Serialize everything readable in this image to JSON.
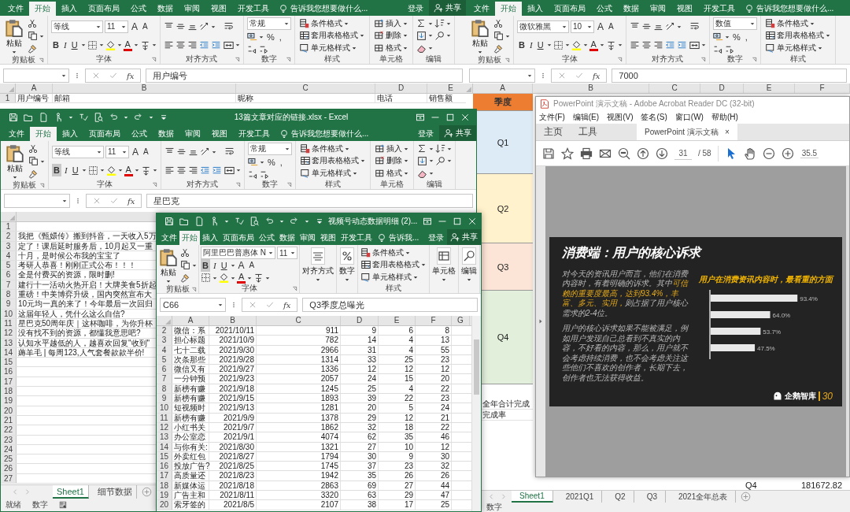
{
  "windows": [
    {
      "kind": "excel_users",
      "tabs": [
        {
          "label": "文件",
          "selected": false
        },
        {
          "label": "开始",
          "selected": true
        },
        {
          "label": "插入",
          "selected": false
        },
        {
          "label": "页面布局",
          "selected": false
        },
        {
          "label": "公式",
          "selected": false
        },
        {
          "label": "数据",
          "selected": false
        },
        {
          "label": "审阅",
          "selected": false
        },
        {
          "label": "视图",
          "selected": false
        },
        {
          "label": "开发工具",
          "selected": false
        }
      ],
      "tell_me": "告诉我您想要做什么...",
      "sign_in": "登录",
      "share": "共享",
      "ribbon": [
        {
          "kind": "clipboard",
          "label": "剪贴板",
          "paste": "粘贴"
        },
        {
          "kind": "font",
          "label": "字体",
          "font": "等线",
          "size": "11",
          "grow": "A",
          "shrink": "A",
          "format_buttons": [
            {
              "label": "B",
              "selected": false
            },
            {
              "label": "I",
              "selected": false
            },
            {
              "label": "U",
              "selected": false
            }
          ],
          "color_letter": "A"
        },
        {
          "kind": "align",
          "label": "对齐方式"
        },
        {
          "kind": "number",
          "label": "数字",
          "format": "常规",
          "percent": "%",
          "comma": ","
        },
        {
          "kind": "styles",
          "label": "样式",
          "items": [
            "条件格式",
            "套用表格格式",
            "单元格样式"
          ]
        },
        {
          "kind": "cells",
          "label": "单元格",
          "items": [
            "插入",
            "删除",
            "格式"
          ]
        },
        {
          "kind": "editing",
          "label": "编辑"
        }
      ],
      "fx": "fx",
      "formula": "用户编号",
      "columns": [
        "A",
        "B",
        "C",
        "D",
        "E"
      ],
      "rows": [
        {
          "number": "1",
          "cells": [
            "用户编号",
            "邮箱",
            "昵称",
            "电话",
            "销售额"
          ]
        }
      ]
    },
    {
      "kind": "excel_links",
      "title": "13篇文章对应的链接.xlsx - Excel",
      "tabs": [
        {
          "label": "文件",
          "selected": false
        },
        {
          "label": "开始",
          "selected": true
        },
        {
          "label": "插入",
          "selected": false
        },
        {
          "label": "页面布局",
          "selected": false
        },
        {
          "label": "公式",
          "selected": false
        },
        {
          "label": "数据",
          "selected": false
        },
        {
          "label": "审阅",
          "selected": false
        },
        {
          "label": "视图",
          "selected": false
        },
        {
          "label": "开发工具",
          "selected": false
        }
      ],
      "tell_me": "告诉我您想要做什么...",
      "sign_in": "登录",
      "share": "共享",
      "ribbon": [
        {
          "kind": "clipboard",
          "label": "剪贴板",
          "paste": "粘贴"
        },
        {
          "kind": "font",
          "label": "字体",
          "font": "等线",
          "size": "11",
          "grow": "A",
          "shrink": "A",
          "format_buttons": [
            {
              "label": "B",
              "selected": true
            },
            {
              "label": "I",
              "selected": false
            },
            {
              "label": "U",
              "selected": false
            }
          ],
          "color_letter": "A"
        },
        {
          "kind": "align",
          "label": "对齐方式"
        },
        {
          "kind": "number",
          "label": "数字",
          "format": "常规",
          "percent": "%",
          "comma": ","
        },
        {
          "kind": "styles",
          "label": "样式",
          "items": [
            "条件格式",
            "套用表格格式",
            "单元格样式"
          ]
        },
        {
          "kind": "cells",
          "label": "单元格",
          "items": [
            "插入",
            "删除",
            "格式"
          ]
        },
        {
          "kind": "editing",
          "label": "编辑"
        }
      ],
      "fx": "fx",
      "formula": "星巴克",
      "rows": [
        {
          "number": "1"
        },
        {
          "number": "2",
          "cells": [
            "我把《甄嬛传》搬到抖音，一天收入5万"
          ]
        },
        {
          "number": "3",
          "cells": [
            "定了！课后延时服务后，10月起又一重"
          ]
        },
        {
          "number": "4",
          "cells": [
            "十月，是时候公布我的宝宝了"
          ]
        },
        {
          "number": "5",
          "cells": [
            "考研人恭喜！刚刚正式公布！！！"
          ]
        },
        {
          "number": "6",
          "cells": [
            "全是付费买的资源，限时删!"
          ]
        },
        {
          "number": "7",
          "cells": [
            "建行十一活动火热开启！大牌美食5折起"
          ]
        },
        {
          "number": "8",
          "cells": [
            "重磅！中美博弈升级，国内突然宣布大"
          ]
        },
        {
          "number": "9",
          "cells": [
            "10元均一真的来了！今年最后一次回归"
          ]
        },
        {
          "number": "10",
          "cells": [
            "这届年轻人，凭什么这么自信?"
          ]
        },
        {
          "number": "11",
          "cells": [
            "星巴克50周年庆｜这杯咖啡，为你升杯"
          ]
        },
        {
          "number": "12",
          "cells": [
            "没有找不到的资源，都懂我意思吧?"
          ]
        },
        {
          "number": "13",
          "cells": [
            "认知水平越低的人，越喜欢回复\"收到\""
          ]
        },
        {
          "number": "14",
          "cells": [
            "薅羊毛 | 每周123,人气套餐款款半价!"
          ]
        },
        {
          "number": "15"
        },
        {
          "number": "16"
        },
        {
          "number": "17"
        },
        {
          "number": "18"
        },
        {
          "number": "19"
        },
        {
          "number": "20"
        },
        {
          "number": "21"
        },
        {
          "number": "22"
        },
        {
          "number": "23"
        },
        {
          "number": "24"
        },
        {
          "number": "25"
        },
        {
          "number": "26"
        },
        {
          "number": "27"
        }
      ],
      "sheet_tabs": [
        {
          "label": "Sheet1",
          "selected": true
        },
        {
          "label": "细节数据",
          "selected": false
        }
      ],
      "status": [
        "就绪",
        "数字"
      ]
    },
    {
      "kind": "excel_video",
      "title": "视频号动态数据明细 (2)...",
      "tabs": [
        {
          "label": "文件",
          "selected": false
        },
        {
          "label": "开始",
          "selected": true
        },
        {
          "label": "插入",
          "selected": false
        },
        {
          "label": "页面布局",
          "selected": false
        },
        {
          "label": "公式",
          "selected": false
        },
        {
          "label": "数据",
          "selected": false
        },
        {
          "label": "审阅",
          "selected": false
        },
        {
          "label": "视图",
          "selected": false
        },
        {
          "label": "开发工具",
          "selected": false
        }
      ],
      "tell_me": "告诉我...",
      "sign_in": "登录",
      "share": "共享",
      "ribbon": [
        {
          "kind": "clipboard",
          "label": "剪贴板",
          "paste": "粘贴"
        },
        {
          "kind": "font_compact",
          "label": "字体",
          "font": "阿里巴巴普惠体 N",
          "size": "11",
          "grow": "A",
          "shrink": "A",
          "format_buttons": [
            {
              "label": "B",
              "selected": true
            },
            {
              "label": "I",
              "selected": false
            },
            {
              "label": "U",
              "selected": false
            }
          ],
          "color_letter": "A"
        },
        {
          "kind": "align_button",
          "text": "对齐方式"
        },
        {
          "kind": "number_button",
          "text": "数字"
        },
        {
          "kind": "styles",
          "label": "样式",
          "items": [
            "条件格式",
            "套用表格格式",
            "单元格样式"
          ]
        },
        {
          "kind": "cells_button",
          "text": "单元格"
        },
        {
          "kind": "editing_button",
          "text": "编辑"
        }
      ],
      "name_box": "C66",
      "fx": "fx",
      "formula": "Q3季度总曝光",
      "columns": [
        "A",
        "B",
        "C",
        "D",
        "E",
        "F",
        "G"
      ],
      "rows": [
        {
          "number": "2",
          "cells": [
            "微信：系",
            "2021/10/11",
            "911",
            "9",
            "6",
            "8"
          ]
        },
        {
          "number": "3",
          "cells": [
            "担心标题",
            "2021/10/9",
            "782",
            "14",
            "4",
            "13"
          ]
        },
        {
          "number": "4",
          "cells": [
            "七十二载",
            "2021/9/30",
            "2966",
            "31",
            "4",
            "55"
          ]
        },
        {
          "number": "5",
          "cells": [
            "次条那些",
            "2021/9/28",
            "1314",
            "33",
            "25",
            "23"
          ]
        },
        {
          "number": "6",
          "cells": [
            "微信又有",
            "2021/9/27",
            "1336",
            "12",
            "12",
            "12"
          ]
        },
        {
          "number": "7",
          "cells": [
            "一分钟预",
            "2021/9/23",
            "2057",
            "24",
            "15",
            "20"
          ]
        },
        {
          "number": "8",
          "cells": [
            "新榜有赚",
            "2021/9/18",
            "1245",
            "25",
            "4",
            "22"
          ]
        },
        {
          "number": "9",
          "cells": [
            "新榜有赚",
            "2021/9/15",
            "1893",
            "39",
            "22",
            "23"
          ]
        },
        {
          "number": "10",
          "cells": [
            "短视频时",
            "2021/9/13",
            "1281",
            "20",
            "5",
            "24"
          ]
        },
        {
          "number": "11",
          "cells": [
            "新榜有赚",
            "2021/9/9",
            "1378",
            "29",
            "12",
            "21"
          ]
        },
        {
          "number": "12",
          "cells": [
            "小红书关",
            "2021/9/7",
            "1862",
            "32",
            "18",
            "22"
          ]
        },
        {
          "number": "13",
          "cells": [
            "办公室恋",
            "2021/9/1",
            "4074",
            "62",
            "35",
            "46"
          ]
        },
        {
          "number": "14",
          "cells": [
            "与你有关:",
            "2021/8/30",
            "1321",
            "27",
            "10",
            "12"
          ]
        },
        {
          "number": "15",
          "cells": [
            "外卖红包",
            "2021/8/27",
            "1794",
            "30",
            "9",
            "30"
          ]
        },
        {
          "number": "16",
          "cells": [
            "投放广告?",
            "2021/8/25",
            "1745",
            "37",
            "23",
            "32"
          ]
        },
        {
          "number": "17",
          "cells": [
            "高质量还",
            "2021/8/23",
            "1942",
            "35",
            "26",
            "26"
          ]
        },
        {
          "number": "18",
          "cells": [
            "新媒体运",
            "2021/8/18",
            "2863",
            "69",
            "27",
            "44"
          ]
        },
        {
          "number": "19",
          "cells": [
            "广告主和",
            "2021/8/11",
            "3320",
            "63",
            "29",
            "47"
          ]
        },
        {
          "number": "20",
          "cells": [
            "索牙签的",
            "2021/8/5",
            "2107",
            "38",
            "17",
            "25"
          ]
        }
      ]
    },
    {
      "kind": "excel_quarters",
      "tabs": [
        {
          "label": "文件",
          "selected": false
        },
        {
          "label": "开始",
          "selected": true
        },
        {
          "label": "插入",
          "selected": false
        },
        {
          "label": "页面布局",
          "selected": false
        },
        {
          "label": "公式",
          "selected": false
        },
        {
          "label": "数据",
          "selected": false
        },
        {
          "label": "审阅",
          "selected": false
        },
        {
          "label": "视图",
          "selected": false
        },
        {
          "label": "开发工具",
          "selected": false
        }
      ],
      "tell_me": "告诉我您想要做什么...",
      "ribbon": [
        {
          "kind": "clipboard",
          "label": "剪贴板",
          "paste": "粘贴"
        },
        {
          "kind": "font",
          "label": "字体",
          "font": "微软雅黑",
          "size": "10",
          "grow": "A",
          "shrink": "A",
          "format_buttons": [
            {
              "label": "B",
              "selected": false
            },
            {
              "label": "I",
              "selected": false
            },
            {
              "label": "U",
              "selected": false
            }
          ],
          "color_letter": "A"
        },
        {
          "kind": "align",
          "label": "对齐方式"
        },
        {
          "kind": "number",
          "label": "数字",
          "format": "数值",
          "percent": "%",
          "comma": ","
        },
        {
          "kind": "styles",
          "label": "样式",
          "items": [
            "条件格式",
            "套用表格格式",
            "单元格样式"
          ]
        }
      ],
      "fx": "fx",
      "formula": "7000",
      "columns": [
        "A",
        "B",
        "C",
        "D",
        "E",
        "F"
      ],
      "column_a": [
        {
          "text": "季度",
          "color": "#ed7d31"
        },
        {
          "text": "Q1",
          "color": "#ddebf7"
        },
        {
          "text": "Q2",
          "color": "#fff2cc"
        },
        {
          "text": "Q3",
          "color": "#fce4d6"
        },
        {
          "text": "Q4",
          "color": "#e2efda"
        },
        {
          "text": "全年合计完成"
        },
        {
          "text": "完成率"
        }
      ],
      "bottom_row": [
        "Q4",
        "181672.82"
      ],
      "sheet_tabs": [
        {
          "label": "Sheet1",
          "selected": true
        },
        {
          "label": "2021Q1",
          "selected": false
        },
        {
          "label": "Q2",
          "selected": false
        },
        {
          "label": "Q3",
          "selected": false
        },
        {
          "label": "2021全年总表",
          "selected": false
        }
      ],
      "status": [
        "数字"
      ]
    },
    {
      "kind": "acrobat",
      "title": "PowerPoint 演示文稿 - Adobe Acrobat Reader DC (32-bit)",
      "menu": [
        "文件(F)",
        "编辑(E)",
        "视图(V)",
        "签名(S)",
        "窗口(W)",
        "帮助(H)"
      ],
      "tabs": [
        {
          "kind": "nav",
          "label": "主页",
          "selected": false
        },
        {
          "kind": "nav",
          "label": "工具",
          "selected": false
        },
        {
          "kind": "document",
          "label": "PowerPoint 演示文稿",
          "selected": true,
          "close": "×"
        }
      ],
      "page": "31",
      "page_total": "/ 58",
      "zoom": "35.5",
      "slide": {
        "title": "消费端：用户的核心诉求",
        "paragraphs": [
          "对今天的资讯用户而言，他们在消费内容时，有着明确的诉求。其中**可信赖的重要度最高，达到93.4%，丰富、多元、实用，**则占据了用户核心需求的2-4位。",
          "用户的核心诉求如果不能被满足，例如用户发现自己总看到不真实的内容，不好看的内容，那么，用户就不会考虑持续消费，也不会考虑关注这些他们不喜欢的创作者，长期下去，创作者也无法获得收益。"
        ],
        "bar_chart": {
          "title": "用户在消费资讯内容时，最看重的方面",
          "value_labels": [
            "93.4%",
            "64.0%",
            "53.7%",
            "47.5%"
          ]
        },
        "logo": "企鹅智库",
        "number": "30"
      }
    }
  ]
}
